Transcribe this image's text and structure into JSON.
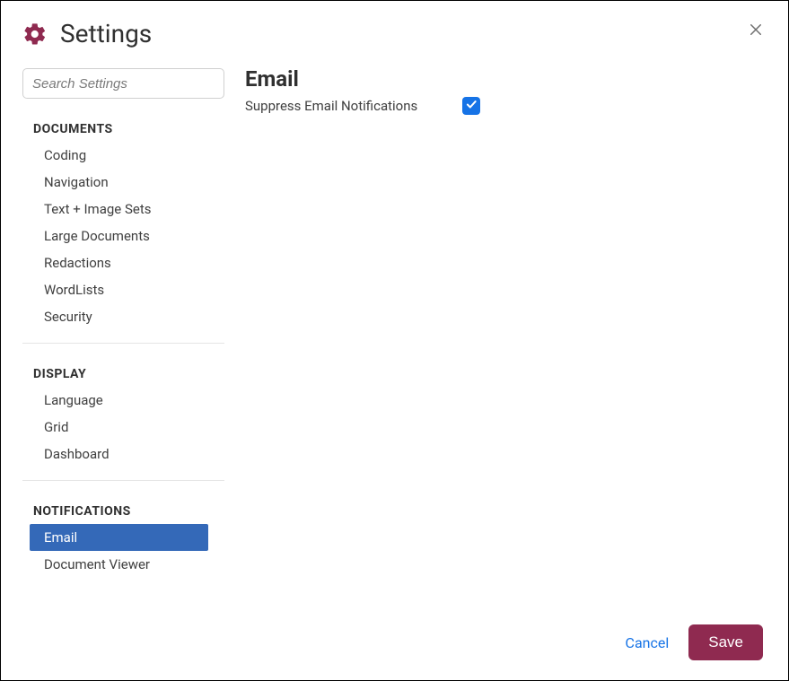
{
  "header": {
    "title": "Settings"
  },
  "search": {
    "placeholder": "Search Settings"
  },
  "sidebar": {
    "sections": [
      {
        "name": "documents",
        "header": "DOCUMENTS",
        "items": [
          {
            "label": "Coding"
          },
          {
            "label": "Navigation"
          },
          {
            "label": "Text + Image Sets"
          },
          {
            "label": "Large Documents"
          },
          {
            "label": "Redactions"
          },
          {
            "label": "WordLists"
          },
          {
            "label": "Security"
          }
        ]
      },
      {
        "name": "display",
        "header": "DISPLAY",
        "items": [
          {
            "label": "Language"
          },
          {
            "label": "Grid"
          },
          {
            "label": "Dashboard"
          }
        ]
      },
      {
        "name": "notifications",
        "header": "NOTIFICATIONS",
        "items": [
          {
            "label": "Email",
            "active": true
          },
          {
            "label": "Document Viewer"
          }
        ]
      }
    ]
  },
  "main": {
    "heading": "Email",
    "setting_label": "Suppress Email Notifications",
    "setting_checked": true
  },
  "footer": {
    "cancel_label": "Cancel",
    "save_label": "Save"
  },
  "colors": {
    "accent": "#8f2a50",
    "primary_blue": "#3469b8",
    "link_blue": "#1673e6"
  }
}
